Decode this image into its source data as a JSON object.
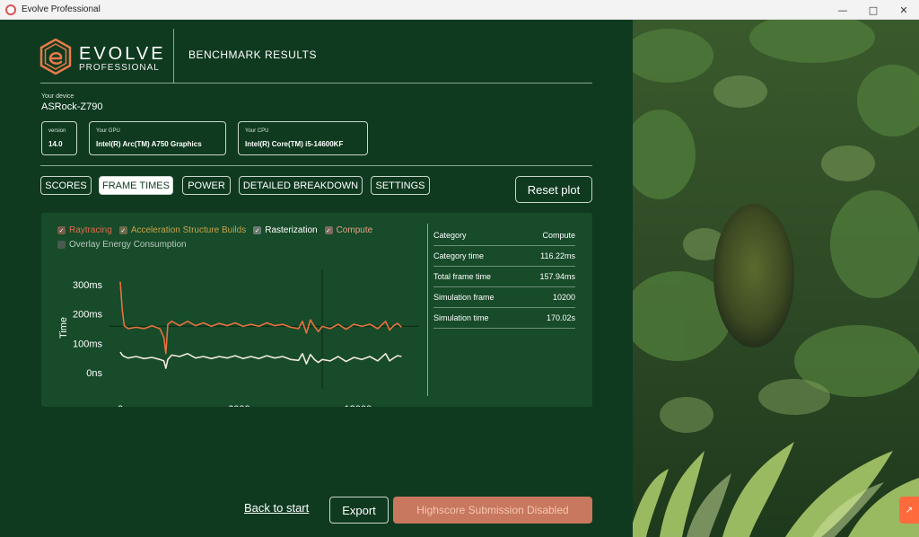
{
  "window": {
    "title": "Evolve Professional"
  },
  "brand": {
    "name": "EVOLVE",
    "sub": "PROFESSIONAL",
    "accent": "#e87a4a"
  },
  "page_heading": "BENCHMARK RESULTS",
  "device": {
    "label": "Your device",
    "name": "ASRock-Z790"
  },
  "info": {
    "version_label": "version",
    "version_value": "14.0",
    "gpu_label": "Your GPU",
    "gpu_value": "Intel(R) Arc(TM) A750 Graphics",
    "cpu_label": "Your CPU",
    "cpu_value": "Intel(R) Core(TM) i5-14600KF"
  },
  "tabs": [
    {
      "label": "SCORES",
      "active": false
    },
    {
      "label": "FRAME TIMES",
      "active": true
    },
    {
      "label": "POWER",
      "active": false
    },
    {
      "label": "DETAILED BREAKDOWN",
      "active": false
    },
    {
      "label": "SETTINGS",
      "active": false
    }
  ],
  "reset_label": "Reset plot",
  "legend": [
    {
      "label": "Raytracing",
      "checked": true,
      "color": "#e06a4a"
    },
    {
      "label": "Acceleration Structure Builds",
      "checked": true,
      "color": "#c8a24a"
    },
    {
      "label": "Rasterization",
      "checked": true,
      "color": "#ffffff"
    },
    {
      "label": "Compute",
      "checked": true,
      "color": "#e8a080"
    },
    {
      "label": "Overlay Energy Consumption",
      "checked": false,
      "color": "#b8c8bd"
    }
  ],
  "stats": {
    "header": {
      "label": "Category",
      "value": "Compute"
    },
    "rows": [
      {
        "label": "Category time",
        "value": "116.22ms"
      },
      {
        "label": "Total frame time",
        "value": "157.94ms"
      },
      {
        "label": "Simulation frame",
        "value": "10200"
      },
      {
        "label": "Simulation time",
        "value": "170.02s"
      }
    ]
  },
  "bottom": {
    "back_label": "Back to start",
    "export_label": "Export",
    "submit_label": "Highscore Submission Disabled"
  },
  "chart_data": {
    "type": "line",
    "ylabel": "Time",
    "xlabel": "",
    "y_ticks": [
      "300ms",
      "200ms",
      "100ms",
      "0ns"
    ],
    "x_ticks": [
      "0",
      "6000",
      "12000"
    ],
    "xlim": [
      0,
      14500
    ],
    "ylim": [
      0,
      300
    ],
    "crosshair_x": 10200,
    "crosshair_y": 157.94,
    "series": [
      {
        "color": "#e8703f",
        "x": [
          0,
          100,
          200,
          400,
          800,
          1200,
          1600,
          2000,
          2200,
          2300,
          2400,
          2600,
          3000,
          3400,
          3800,
          4200,
          4600,
          5000,
          5400,
          5800,
          6200,
          6600,
          7000,
          7400,
          7800,
          8200,
          8600,
          9000,
          9200,
          9400,
          9600,
          9800,
          10000,
          10200,
          10600,
          11000,
          11400,
          11800,
          12200,
          12600,
          13000,
          13400,
          13600,
          13800,
          14000,
          14200
        ],
        "y": [
          310,
          215,
          160,
          150,
          155,
          150,
          160,
          150,
          120,
          65,
          165,
          175,
          160,
          175,
          160,
          170,
          158,
          168,
          160,
          170,
          158,
          165,
          158,
          170,
          160,
          165,
          155,
          150,
          175,
          135,
          180,
          158,
          140,
          158,
          150,
          165,
          148,
          165,
          158,
          165,
          150,
          175,
          145,
          160,
          168,
          155
        ]
      },
      {
        "color": "#f2e8dc",
        "x": [
          0,
          100,
          200,
          400,
          800,
          1200,
          1600,
          2000,
          2200,
          2300,
          2400,
          2600,
          3000,
          3400,
          3800,
          4200,
          4600,
          5000,
          5400,
          5800,
          6200,
          6600,
          7000,
          7400,
          7800,
          8200,
          8600,
          9000,
          9200,
          9400,
          9600,
          9800,
          10000,
          10200,
          10600,
          11000,
          11400,
          11800,
          12200,
          12600,
          13000,
          13400,
          13600,
          13800,
          14000,
          14200
        ],
        "y": [
          70,
          60,
          55,
          50,
          55,
          48,
          52,
          45,
          40,
          15,
          45,
          60,
          55,
          65,
          50,
          55,
          48,
          55,
          50,
          58,
          48,
          55,
          48,
          58,
          50,
          55,
          45,
          42,
          65,
          30,
          62,
          45,
          35,
          45,
          40,
          55,
          38,
          52,
          45,
          55,
          40,
          65,
          40,
          50,
          58,
          55
        ]
      }
    ]
  }
}
